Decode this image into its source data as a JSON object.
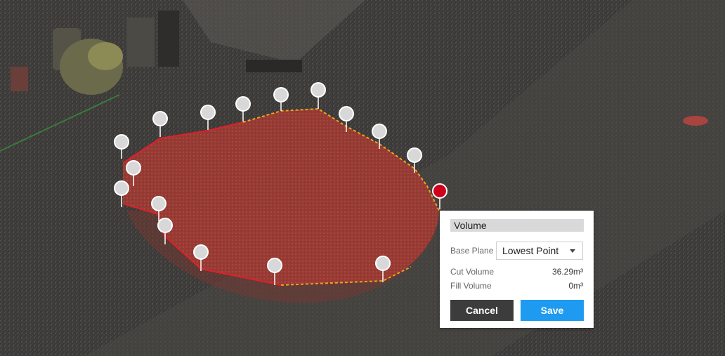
{
  "panel": {
    "title": "Volume",
    "base_plane_label": "Base Plane",
    "base_plane_value": "Lowest Point",
    "cut_volume_label": "Cut Volume",
    "cut_volume_value": "36.29m³",
    "fill_volume_label": "Fill Volume",
    "fill_volume_value": "0m³",
    "cancel_label": "Cancel",
    "save_label": "Save"
  },
  "colors": {
    "accent": "#1e9bf0",
    "mound": "#a8332c",
    "active_pin": "#d0021b",
    "boundary": "#f0a020"
  }
}
